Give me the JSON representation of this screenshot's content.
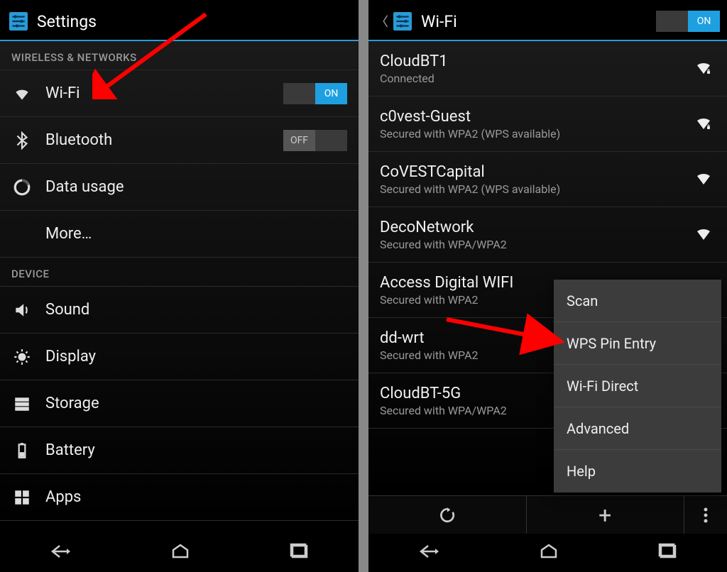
{
  "left": {
    "header_title": "Settings",
    "sections": {
      "wireless": "Wireless & Networks",
      "device": "Device"
    },
    "rows": {
      "wifi": "Wi-Fi",
      "wifi_toggle": "ON",
      "bluetooth": "Bluetooth",
      "bluetooth_toggle": "OFF",
      "data": "Data usage",
      "more": "More…",
      "sound": "Sound",
      "display": "Display",
      "storage": "Storage",
      "battery": "Battery",
      "apps": "Apps"
    }
  },
  "right": {
    "header_title": "Wi-Fi",
    "header_toggle": "ON",
    "networks": [
      {
        "ssid": "CloudBT1",
        "sub": "Connected",
        "locked": true
      },
      {
        "ssid": "c0vest-Guest",
        "sub": "Secured with WPA2 (WPS available)",
        "locked": true
      },
      {
        "ssid": "CoVESTCapital",
        "sub": "Secured with WPA2 (WPS available)",
        "locked": false
      },
      {
        "ssid": "DecoNetwork",
        "sub": "Secured with WPA/WPA2",
        "locked": false
      },
      {
        "ssid": "Access Digital WIFI",
        "sub": "Secured with WPA2",
        "locked": false
      },
      {
        "ssid": "dd-wrt",
        "sub": "Secured with WPA2",
        "locked": false
      },
      {
        "ssid": "CloudBT-5G",
        "sub": "Secured with WPA/WPA2",
        "locked": false
      }
    ],
    "popup": {
      "scan": "Scan",
      "wps": "WPS Pin Entry",
      "direct": "Wi-Fi Direct",
      "advanced": "Advanced",
      "help": "Help"
    }
  }
}
